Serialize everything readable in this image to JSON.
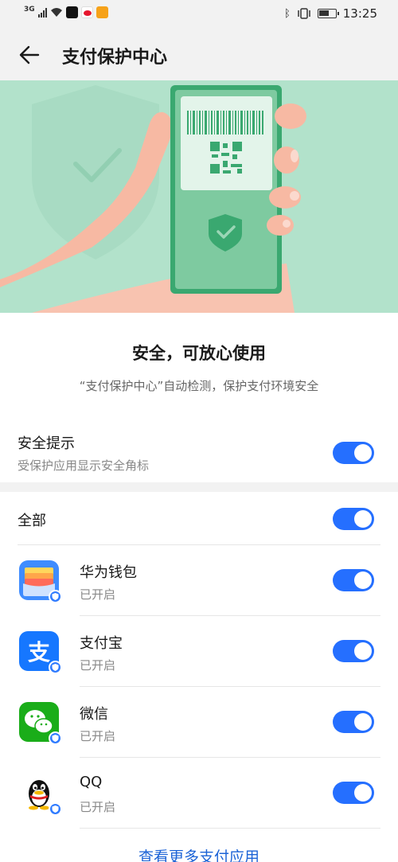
{
  "status_bar": {
    "network": "3G",
    "time": "13:25"
  },
  "header": {
    "title": "支付保护中心"
  },
  "hero": {
    "illustration": "hand-holding-phone-with-qr-code-and-shield"
  },
  "headline": {
    "title": "安全，可放心使用",
    "subtitle": "“支付保护中心”自动检测，保护支付环境安全"
  },
  "security_tip": {
    "title": "安全提示",
    "subtitle": "受保护应用显示安全角标",
    "enabled": true
  },
  "all": {
    "label": "全部",
    "enabled": true
  },
  "apps": [
    {
      "name": "华为钱包",
      "status": "已开启",
      "icon": "huawei-wallet-icon",
      "enabled": true
    },
    {
      "name": "支付宝",
      "status": "已开启",
      "icon": "alipay-icon",
      "enabled": true
    },
    {
      "name": "微信",
      "status": "已开启",
      "icon": "wechat-icon",
      "enabled": true
    },
    {
      "name": "QQ",
      "status": "已开启",
      "icon": "qq-icon",
      "enabled": true
    }
  ],
  "more_link": "查看更多支付应用",
  "colors": {
    "accent": "#256fff",
    "hero_bg": "#b2e2cb",
    "link": "#1c63d6"
  }
}
